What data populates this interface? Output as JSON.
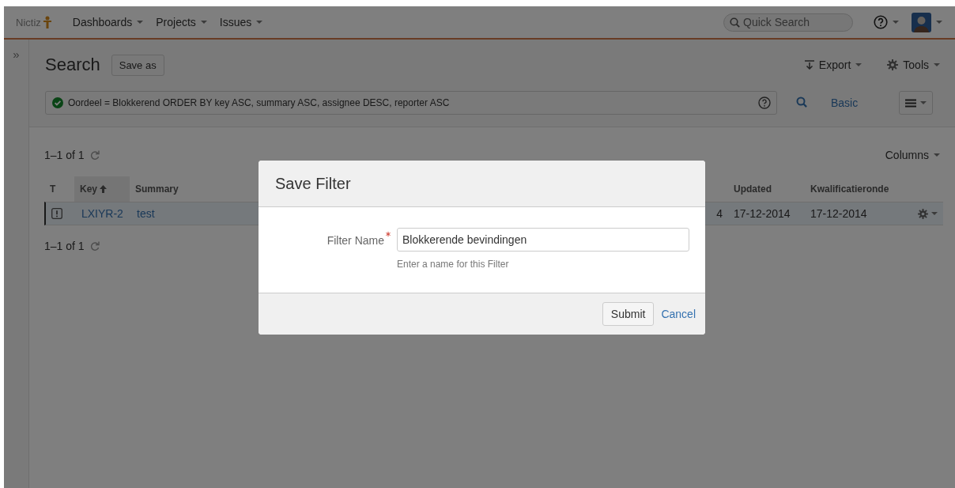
{
  "header": {
    "logo_text": "Nictiz",
    "nav": [
      {
        "label": "Dashboards"
      },
      {
        "label": "Projects"
      },
      {
        "label": "Issues"
      }
    ],
    "quick_search": {
      "placeholder": "Quick Search"
    }
  },
  "sidebar": {
    "toggle": "»"
  },
  "search": {
    "title": "Search",
    "save_as": "Save as",
    "export": "Export",
    "tools": "Tools",
    "query": "Oordeel = Blokkerend ORDER BY key ASC, summary ASC, assignee DESC, reporter ASC",
    "query_valid": true,
    "mode": "Basic"
  },
  "results": {
    "count_top": "1–1 of 1",
    "count_bottom": "1–1 of 1",
    "columns_button": "Columns",
    "table": {
      "columns": [
        {
          "label": "T",
          "sorted": false
        },
        {
          "label": "Key",
          "sorted": true
        },
        {
          "label": "Summary",
          "sorted": false
        },
        {
          "label": "Updated",
          "sorted": false
        },
        {
          "label": "Kwalificatieronde",
          "sorted": false
        }
      ],
      "rows": [
        {
          "selected": true,
          "key": "LXIYR-2",
          "summary": "test",
          "column_4": "4",
          "updated": "17-12-2014",
          "kwalificatieronde": "17-12-2014"
        }
      ]
    }
  },
  "dialog": {
    "title": "Save Filter",
    "field": {
      "label": "Filter Name",
      "required": true,
      "value": "Blokkerende bevindingen",
      "hint": "Enter a name for this Filter"
    },
    "submit": "Submit",
    "cancel": "Cancel"
  }
}
